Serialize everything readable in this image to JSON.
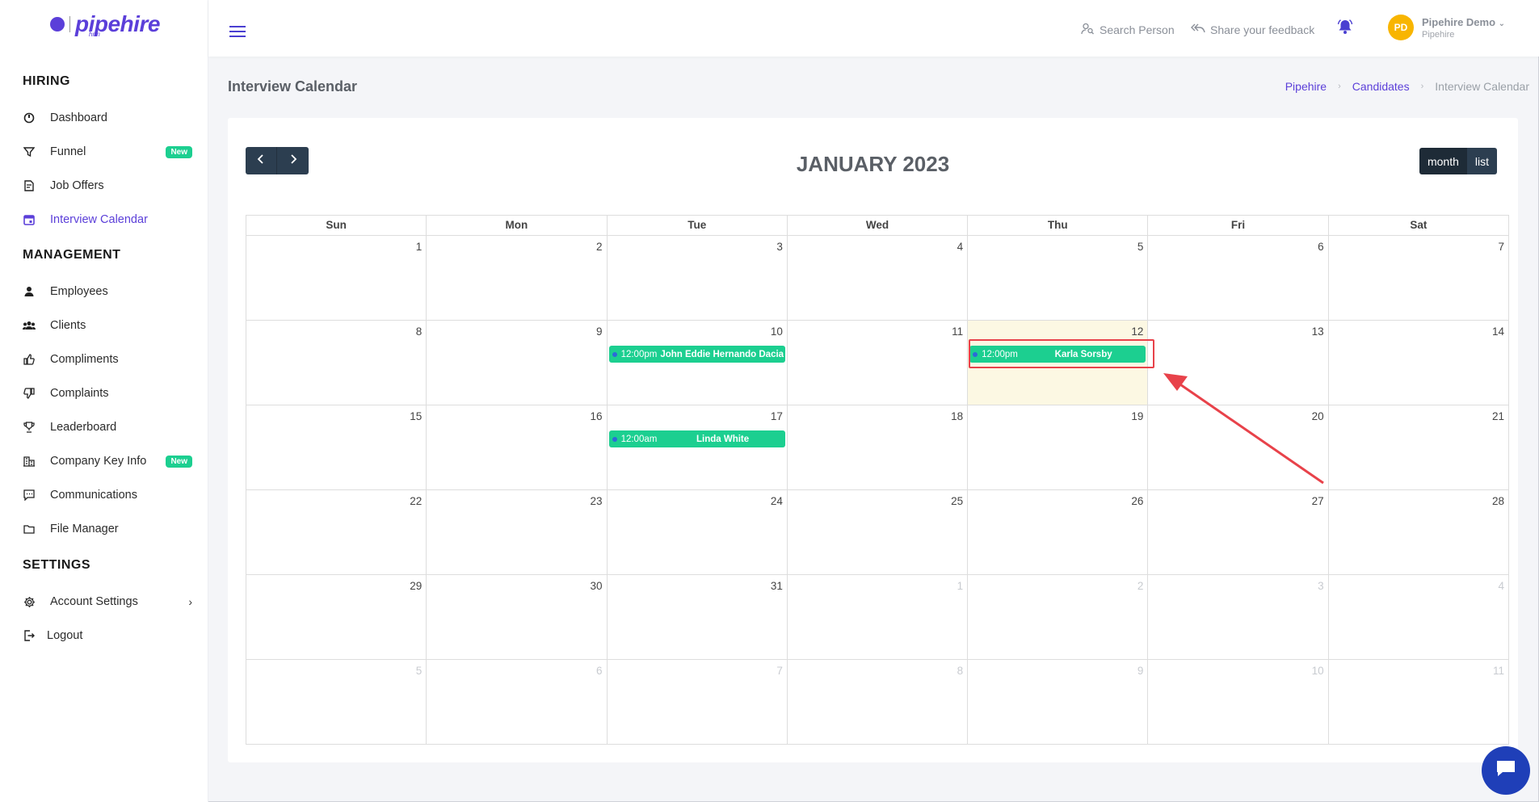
{
  "brand": {
    "name": "pipehire",
    "sub": "hrm"
  },
  "sidebar": {
    "sections": [
      {
        "title": "HIRING"
      },
      {
        "title": "MANAGEMENT"
      },
      {
        "title": "SETTINGS"
      }
    ],
    "hiring": [
      {
        "label": "Dashboard"
      },
      {
        "label": "Funnel",
        "badge": "New"
      },
      {
        "label": "Job Offers"
      },
      {
        "label": "Interview Calendar"
      }
    ],
    "management": [
      {
        "label": "Employees"
      },
      {
        "label": "Clients"
      },
      {
        "label": "Compliments"
      },
      {
        "label": "Complaints"
      },
      {
        "label": "Leaderboard"
      },
      {
        "label": "Company Key Info",
        "badge": "New"
      },
      {
        "label": "Communications"
      },
      {
        "label": "File Manager"
      }
    ],
    "settings": [
      {
        "label": "Account Settings"
      },
      {
        "label": "Logout"
      }
    ]
  },
  "header": {
    "search_person": "Search Person",
    "feedback": "Share your feedback",
    "profile": {
      "initials": "PD",
      "name": "Pipehire Demo",
      "org": "Pipehire"
    }
  },
  "page": {
    "title": "Interview Calendar",
    "breadcrumb": [
      "Pipehire",
      "Candidates",
      "Interview Calendar"
    ]
  },
  "calendar": {
    "title": "JANUARY 2023",
    "views": {
      "month": "month",
      "list": "list"
    },
    "weekdays": [
      "Sun",
      "Mon",
      "Tue",
      "Wed",
      "Thu",
      "Fri",
      "Sat"
    ],
    "weeks": [
      [
        "1",
        "2",
        "3",
        "4",
        "5",
        "6",
        "7"
      ],
      [
        "8",
        "9",
        "10",
        "11",
        "12",
        "13",
        "14"
      ],
      [
        "15",
        "16",
        "17",
        "18",
        "19",
        "20",
        "21"
      ],
      [
        "22",
        "23",
        "24",
        "25",
        "26",
        "27",
        "28"
      ],
      [
        "29",
        "30",
        "31",
        "1",
        "2",
        "3",
        "4"
      ],
      [
        "5",
        "6",
        "7",
        "8",
        "9",
        "10",
        "11"
      ]
    ],
    "events": [
      {
        "time": "12:00pm",
        "title": "John Eddie Hernando Dacia"
      },
      {
        "time": "12:00pm",
        "title": "Karla Sorsby"
      },
      {
        "time": "12:00am",
        "title": "Linda White"
      }
    ]
  },
  "colors": {
    "accent": "#5b3fd9",
    "event": "#1ccf90",
    "today": "#fcf8e3",
    "annotation": "#e8424a"
  }
}
